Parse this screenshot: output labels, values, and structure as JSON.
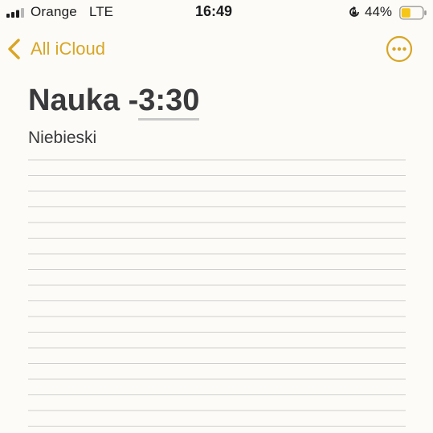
{
  "status_bar": {
    "carrier": "Orange",
    "network": "LTE",
    "time": "16:49",
    "battery_percent": "44%",
    "icons": [
      "signal-bars-icon",
      "rotation-lock-icon",
      "battery-icon"
    ]
  },
  "battery": {
    "level": 0.44,
    "color": "#f5c518"
  },
  "nav": {
    "back_label": "All iCloud",
    "back_icon": "chevron-left-icon",
    "more_icon": "ellipsis-circle-icon"
  },
  "note": {
    "title_prefix": "Nauka -",
    "title_time": "3:30",
    "body": "Niebieski"
  },
  "colors": {
    "accent": "#d9a524",
    "background": "#fcfbf7",
    "ruled_line": "#cfcfcf"
  }
}
